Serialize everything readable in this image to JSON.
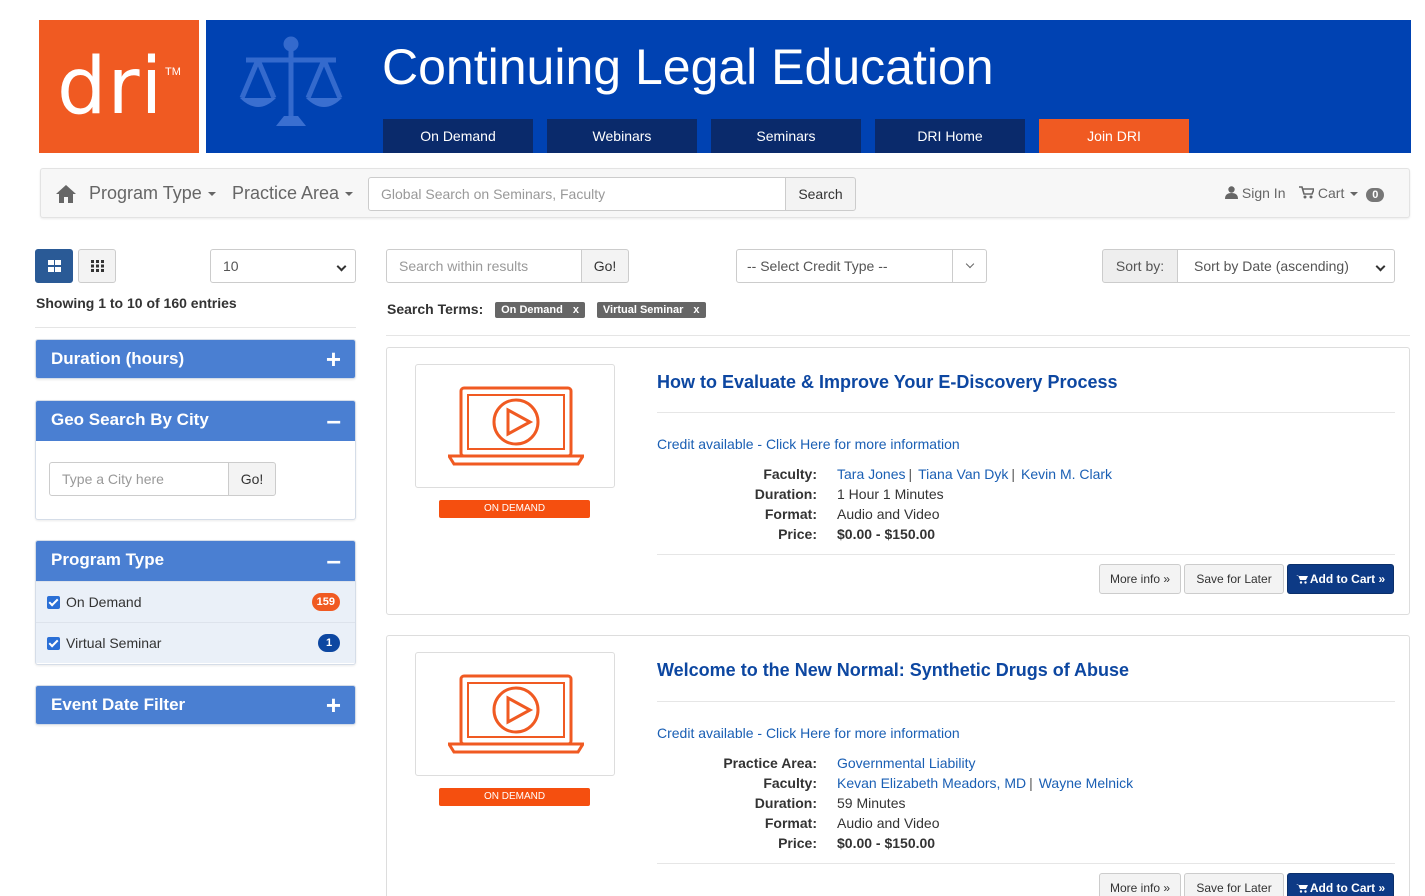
{
  "header": {
    "logo_text": "dri",
    "logo_tm": "TM",
    "title": "Continuing Legal Education",
    "nav": [
      "On Demand",
      "Webinars",
      "Seminars",
      "DRI Home",
      "Join DRI"
    ],
    "brand_color": "#0042b2",
    "accent_color": "#f05a22"
  },
  "topbar": {
    "home_icon": "home-icon",
    "program_type": "Program Type",
    "practice_area": "Practice Area",
    "search_placeholder": "Global Search on Seminars, Faculty",
    "search_button": "Search",
    "sign_in": "Sign In",
    "cart": "Cart",
    "cart_count": "0"
  },
  "left": {
    "page_size": "10",
    "showing": "Showing 1 to 10 of 160 entries",
    "panels": {
      "duration": {
        "title": "Duration (hours)",
        "sign": "+"
      },
      "geo": {
        "title": "Geo Search By City",
        "sign": "–",
        "placeholder": "Type a City here",
        "button": "Go!"
      },
      "program_type": {
        "title": "Program Type",
        "sign": "–",
        "items": [
          {
            "label": "On Demand",
            "count": "159",
            "badge_color": "#f05a22"
          },
          {
            "label": "Virtual Seminar",
            "count": "1",
            "badge_color": "#0d47a1"
          }
        ]
      },
      "event_date": {
        "title": "Event Date Filter",
        "sign": "+"
      }
    }
  },
  "filters": {
    "within_placeholder": "Search within results",
    "within_button": "Go!",
    "credit_type": "-- Select Credit Type --",
    "sort_label": "Sort by:",
    "sort_value": "Sort by Date (ascending)",
    "search_terms_label": "Search Terms:",
    "terms": [
      "On Demand",
      "Virtual Seminar"
    ],
    "term_remove": "x"
  },
  "results": [
    {
      "badge": "ON DEMAND",
      "title": "How to Evaluate & Improve Your E-Discovery Process",
      "credit": "Credit available - Click Here for more information",
      "labels": {
        "faculty": "Faculty:",
        "duration": "Duration:",
        "format": "Format:",
        "price": "Price:"
      },
      "faculty": [
        "Tara Jones",
        "Tiana Van Dyk",
        "Kevin M. Clark"
      ],
      "duration": "1 Hour 1 Minutes",
      "format": "Audio and Video",
      "price": "$0.00 - $150.00",
      "buttons": {
        "more": "More info »",
        "save": "Save for Later",
        "add": "Add to Cart »"
      }
    },
    {
      "badge": "ON DEMAND",
      "title": "Welcome to the New Normal: Synthetic Drugs of Abuse",
      "credit": "Credit available - Click Here for more information",
      "labels": {
        "practice_area": "Practice Area:",
        "faculty": "Faculty:",
        "duration": "Duration:",
        "format": "Format:",
        "price": "Price:"
      },
      "practice_area": "Governmental Liability",
      "faculty": [
        "Kevan Elizabeth Meadors, MD",
        "Wayne Melnick"
      ],
      "duration": "59 Minutes",
      "format": "Audio and Video",
      "price": "$0.00 - $150.00",
      "buttons": {
        "more": "More info »",
        "save": "Save for Later",
        "add": "Add to Cart »"
      }
    }
  ],
  "separator": "|"
}
